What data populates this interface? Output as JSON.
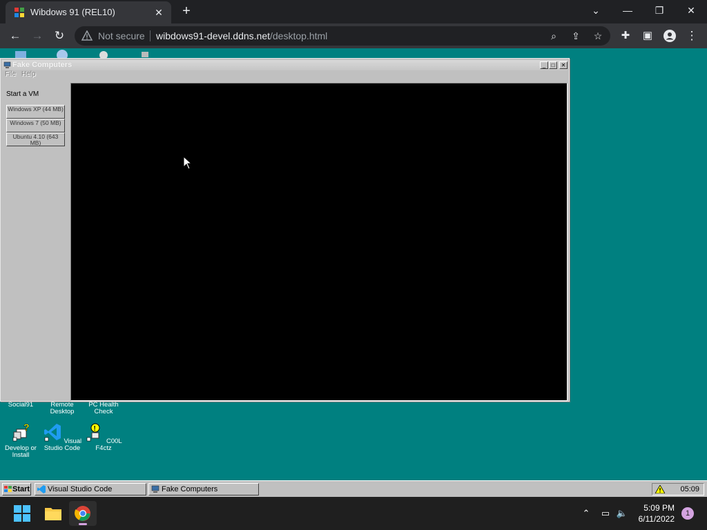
{
  "browser": {
    "tab": {
      "title": "Wibdows 91 (REL10)"
    },
    "omnibox": {
      "security_label": "Not secure",
      "url_host": "wibdows91-devel.ddns.net",
      "url_path": "/desktop.html"
    }
  },
  "desktop": {
    "background_color": "#008080",
    "icons": [
      {
        "label": "Social91",
        "icon": "social91-icon"
      },
      {
        "label": "Remote Desktop",
        "icon": "remote-desktop-icon"
      },
      {
        "label": "PC Health Check",
        "icon": "pc-health-check-icon"
      },
      {
        "label": "Develop or Install",
        "icon": "develop-install-icon"
      },
      {
        "label": "Visual Studio Code",
        "icon": "vscode-icon"
      },
      {
        "label": "C00L F4ctz",
        "icon": "cool-facts-icon"
      }
    ]
  },
  "fake_computers_window": {
    "title": "Fake Computers",
    "menu": [
      "File",
      "Help"
    ],
    "sidebar_heading": "Start a VM",
    "vms": [
      {
        "label": "Windows XP (44 MB)"
      },
      {
        "label": "Windows 7 (50 MB)"
      },
      {
        "label": "Ubuntu 4.10 (643 MB)"
      }
    ]
  },
  "wibdows_taskbar": {
    "start_label": "Start",
    "tasks": [
      {
        "label": "Visual Studio Code",
        "icon": "vscode-icon"
      },
      {
        "label": "Fake Computers",
        "icon": "fake-computers-icon"
      }
    ],
    "clock": "05:09"
  },
  "os_taskbar": {
    "apps": [
      "windows-start-icon",
      "file-explorer-icon",
      "chrome-icon"
    ],
    "time": "5:09 PM",
    "date": "6/11/2022",
    "notification_count": "1"
  }
}
